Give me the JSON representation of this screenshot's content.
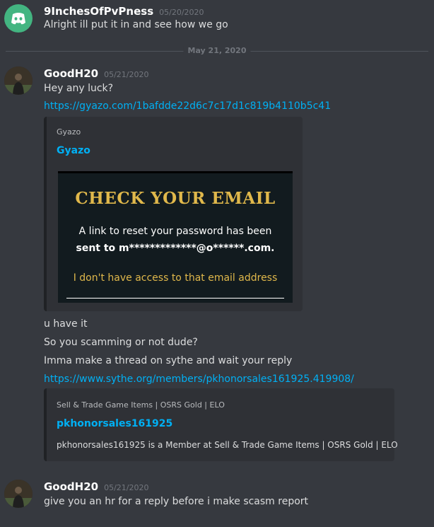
{
  "messages": {
    "first": {
      "author": "9InchesOfPvPness",
      "timestamp": "05/20/2020",
      "text": "Alright ill put it in and see how we go"
    },
    "date_divider": "May 21, 2020",
    "second": {
      "author": "GoodH20",
      "timestamp": "05/21/2020",
      "line1": "Hey any luck?",
      "link1": "https://gyazo.com/1bafdde22d6c7c17d1c819b4110b5c41",
      "embed1": {
        "provider": "Gyazo",
        "title": "Gyazo",
        "image": {
          "heading": "CHECK YOUR EMAIL",
          "body_line1": "A link to reset your password has been",
          "body_line2": "sent to m*************@o******.com.",
          "link": "I don't have access to that email address"
        }
      },
      "line2": "u have it",
      "line3": "So you scamming or not dude?",
      "line4": "Imma make a thread on sythe and wait your reply",
      "link2": "https://www.sythe.org/members/pkhonorsales161925.419908/",
      "embed2": {
        "provider": "Sell & Trade Game Items | OSRS Gold | ELO",
        "title": "pkhonorsales161925",
        "description": "pkhonorsales161925 is a Member at Sell & Trade Game Items | OSRS Gold | ELO"
      }
    },
    "third": {
      "author": "GoodH20",
      "timestamp": "05/21/2020",
      "text": "give you an hr for a reply before i make scasm report"
    }
  },
  "colors": {
    "background": "#36393f",
    "link": "#00b0f4",
    "embed_bg": "#2f3136",
    "discord_green": "#43b581",
    "gold": "#e0b84b"
  }
}
